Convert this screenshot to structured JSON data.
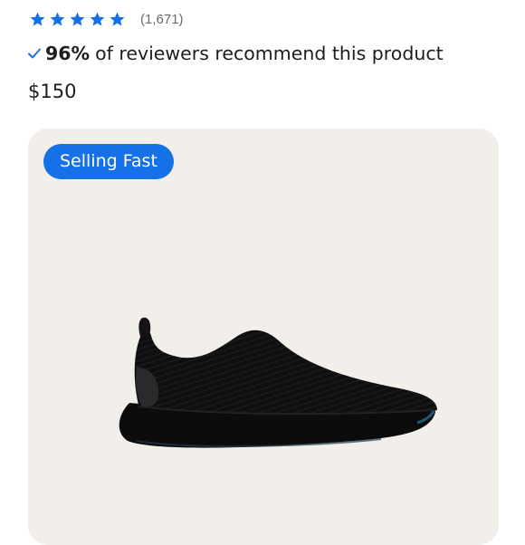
{
  "rating": {
    "stars": 5,
    "star_icon": "star-icon",
    "review_count": "(1,671)",
    "star_color": "#1771e6"
  },
  "recommendation": {
    "icon": "checkmark-icon",
    "percent": "96%",
    "text": "of reviewers recommend this product"
  },
  "price": "$150",
  "product_card": {
    "badge": "Selling Fast",
    "badge_color": "#1771e6",
    "background": "#f2eee9",
    "image": "black-slip-on-sneaker"
  }
}
